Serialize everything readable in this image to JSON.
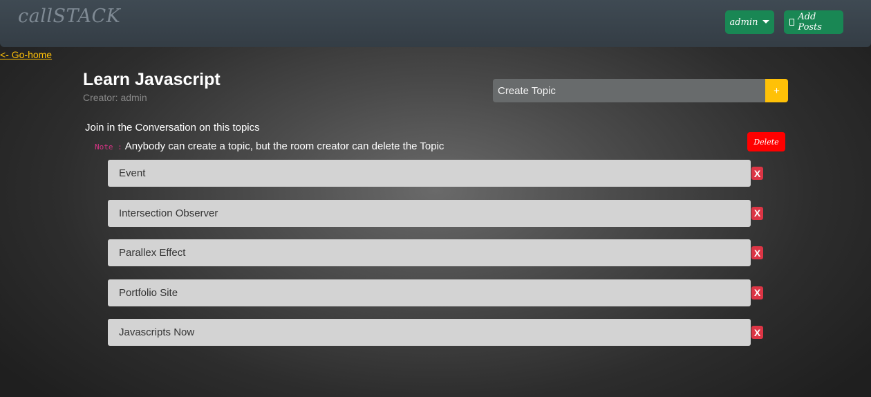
{
  "navbar": {
    "brand": "callSTACK",
    "user_label": "admin",
    "add_posts_label": "Add Posts"
  },
  "home_link": "<- Go-home",
  "room": {
    "title": "Learn Javascript",
    "creator_label": "Creator:",
    "creator_name": "admin"
  },
  "create_topic": {
    "placeholder": "Create Topic",
    "button_label": "+"
  },
  "join_text": "Join in the Conversation on this topics",
  "note": {
    "label": "Note :",
    "text": "Anybody can create a topic, but the room creator can delete the Topic"
  },
  "delete_label": "Delete",
  "topics": [
    {
      "name": "Event",
      "remove_label": "X"
    },
    {
      "name": "Intersection Observer",
      "remove_label": "X"
    },
    {
      "name": "Parallex Effect",
      "remove_label": "X"
    },
    {
      "name": "Portfolio Site",
      "remove_label": "X"
    },
    {
      "name": "Javascripts Now",
      "remove_label": "X"
    }
  ],
  "colors": {
    "navbar": "#3a444c",
    "nav_button": "#198754",
    "accent_yellow": "#ffc107",
    "delete_red": "#ff0000",
    "remove_red": "#dc3545",
    "note_pink": "#d63384"
  }
}
